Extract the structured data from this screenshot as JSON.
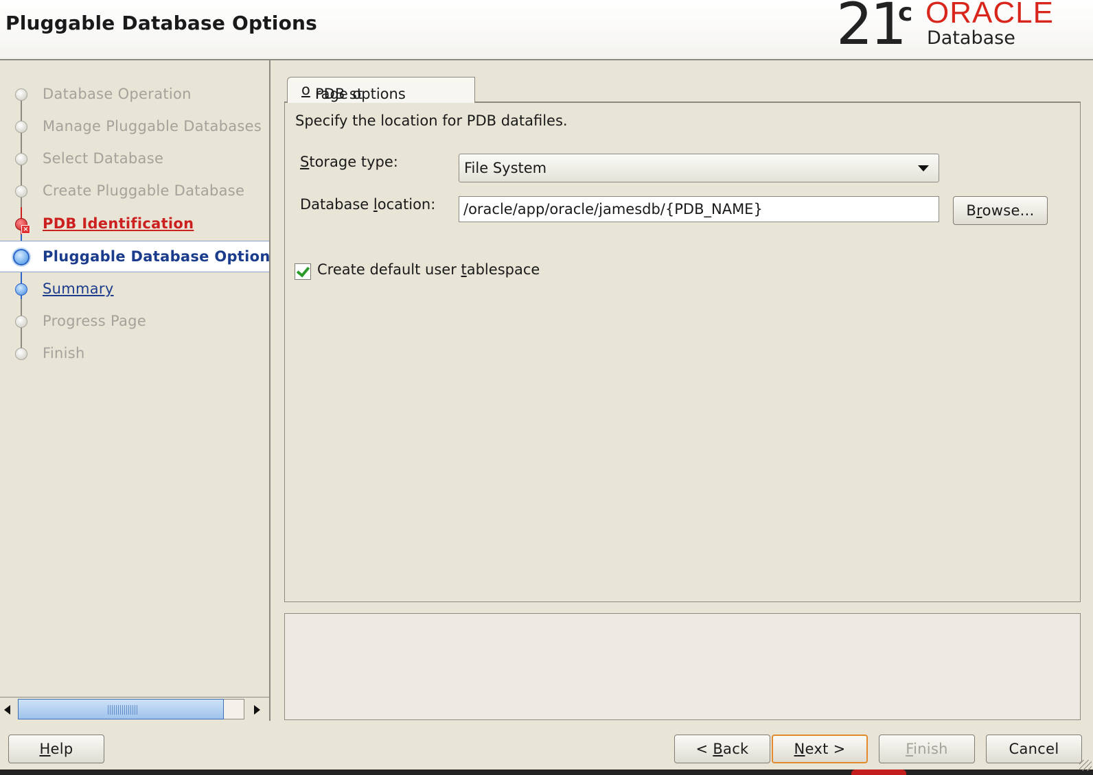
{
  "header": {
    "title": "Pluggable Database Options",
    "logo": {
      "version": "21",
      "version_sup": "c",
      "brand": "ORACLE",
      "product": "Database"
    }
  },
  "nav": {
    "steps": [
      {
        "label": "Database Operation",
        "state": "done"
      },
      {
        "label": "Manage Pluggable Databases",
        "state": "done"
      },
      {
        "label": "Select Database",
        "state": "done"
      },
      {
        "label": "Create Pluggable Database",
        "state": "done"
      },
      {
        "label": "PDB Identification",
        "state": "error"
      },
      {
        "label": "Pluggable Database Options",
        "state": "current"
      },
      {
        "label": "Summary",
        "state": "link"
      },
      {
        "label": "Progress Page",
        "state": "pending"
      },
      {
        "label": "Finish",
        "state": "pending"
      }
    ]
  },
  "tab": {
    "label_pre": "PDB st",
    "label_mn": "o",
    "label_post": "rage options"
  },
  "content": {
    "instruction": "Specify the location for PDB datafiles.",
    "storage_type": {
      "label_mn": "S",
      "label_post": "torage type:",
      "value": "File System"
    },
    "database_location": {
      "label_pre": "Database ",
      "label_mn": "l",
      "label_post": "ocation:",
      "value": "/oracle/app/oracle/jamesdb/{PDB_NAME}"
    },
    "browse_button": {
      "pre": "B",
      "mn": "r",
      "post": "owse..."
    },
    "default_tablespace": {
      "checked": true,
      "label_pre": "Create default user ",
      "label_mn": "t",
      "label_post": "ablespace"
    }
  },
  "footer": {
    "help": {
      "mn": "H",
      "post": "elp"
    },
    "back": {
      "pre": "< ",
      "mn": "B",
      "post": "ack"
    },
    "next": {
      "mn": "N",
      "post": "ext >"
    },
    "finish": {
      "mn": "F",
      "post": "inish"
    },
    "cancel": "Cancel"
  },
  "colors": {
    "error": "#cc1f1f",
    "current": "#1b3c8c",
    "disabled": "#a4a29a",
    "background": "#e8e4d6",
    "oracle_red": "#d9261c"
  }
}
